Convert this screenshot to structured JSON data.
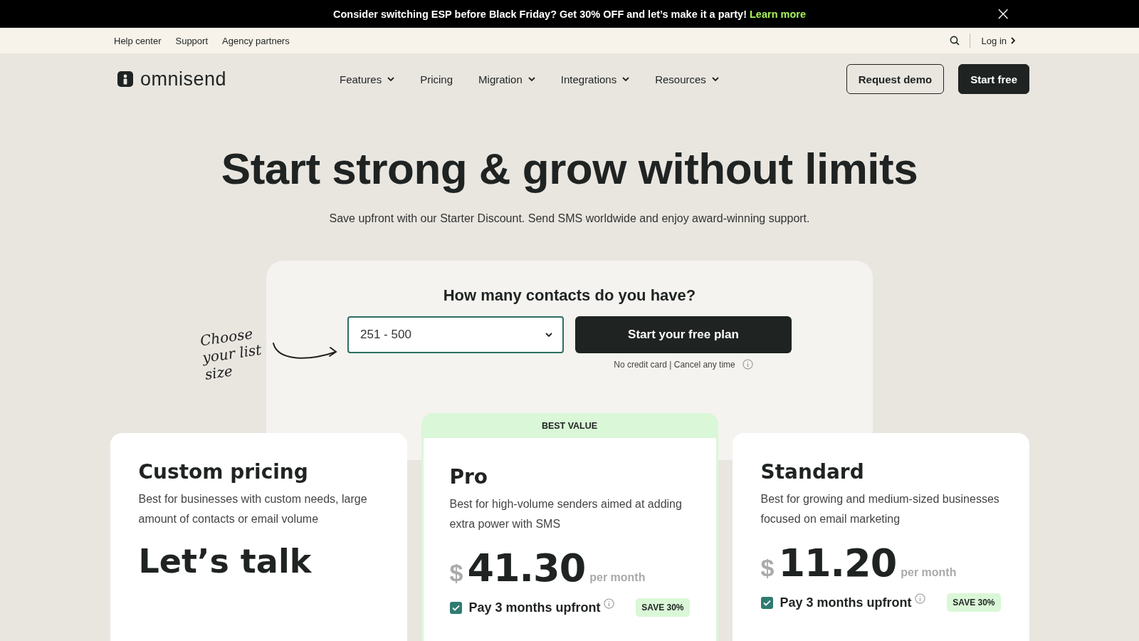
{
  "banner": {
    "text": "Consider switching ESP before Black Friday? Get 30% OFF and let’s make it a party!",
    "link": "Learn more",
    "close": "×"
  },
  "utility_bar": {
    "links": [
      "Help center",
      "Support",
      "Agency partners"
    ],
    "login": "Log in"
  },
  "nav": {
    "logo": "omnisend",
    "items": [
      {
        "label": "Features",
        "dropdown": true
      },
      {
        "label": "Pricing",
        "dropdown": false
      },
      {
        "label": "Migration",
        "dropdown": true
      },
      {
        "label": "Integrations",
        "dropdown": true
      },
      {
        "label": "Resources",
        "dropdown": true
      }
    ],
    "buttons": [
      {
        "label": "Request demo",
        "kind": "outline"
      },
      {
        "label": "Start free",
        "kind": "solid"
      }
    ]
  },
  "hero": {
    "title": "Start strong & grow without limits",
    "subtitle": "Save upfront with our Starter Discount. Send SMS worldwide and enjoy award-winning support."
  },
  "contacts": {
    "question": "How many contacts do you have?",
    "hint": "Choose your list size",
    "select_value": "251 - 500",
    "button": "Start your free plan",
    "note": "No credit card | Cancel any time"
  },
  "plans": [
    {
      "kind": "custom",
      "name": "Custom pricing",
      "description": "Best for businesses with custom needs, large amount of contacts or email volume",
      "headline": "Let’s talk",
      "highlighted": false
    },
    {
      "kind": "price",
      "badge": "BEST VALUE",
      "name": "Pro",
      "description": "Best for high-volume senders aimed at adding extra power with SMS",
      "currency": "$",
      "price": "41.30",
      "period": "per month",
      "upfront": {
        "label": "Pay 3 months upfront",
        "checked": true,
        "save": "SAVE 30%"
      },
      "highlighted": true
    },
    {
      "kind": "price",
      "name": "Standard",
      "description": "Best for growing and medium-sized businesses focused on email marketing",
      "currency": "$",
      "price": "11.20",
      "period": "per month",
      "upfront": {
        "label": "Pay 3 months upfront",
        "checked": true,
        "save": "SAVE 30%"
      },
      "highlighted": false
    }
  ]
}
